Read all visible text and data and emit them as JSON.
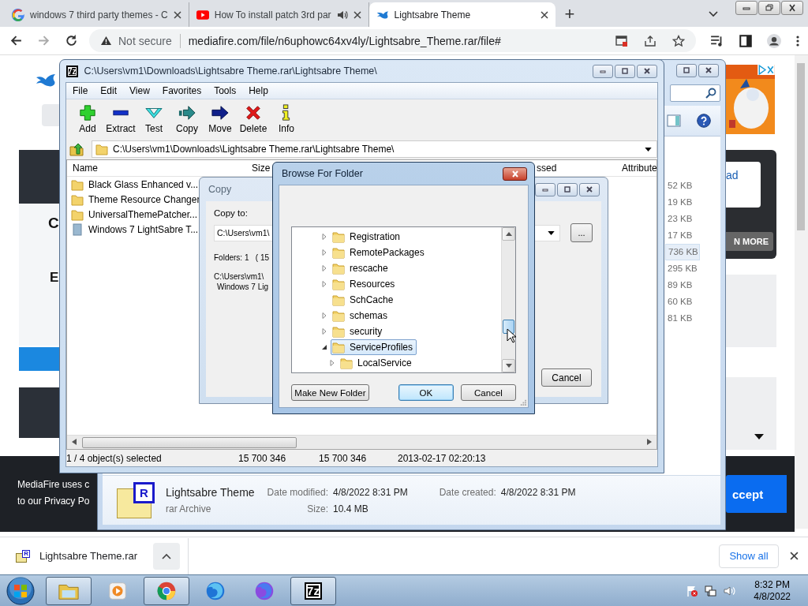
{
  "browser": {
    "tabs": [
      {
        "title": "windows 7 third party themes - C",
        "kind": "google",
        "audio": false,
        "selected": false
      },
      {
        "title": "How To install patch 3rd par",
        "kind": "youtube",
        "audio": true,
        "selected": false
      },
      {
        "title": "Lightsabre Theme",
        "kind": "mediafire",
        "audio": false,
        "selected": true
      }
    ],
    "new_tab": "+",
    "security": "Not secure",
    "url": "mediafire.com/file/n6uphowc64xv4ly/Lightsabre_Theme.rar/file#"
  },
  "webpage": {
    "headings": [
      "C",
      "E"
    ],
    "side_link": "ad",
    "side_button": "N MORE",
    "cookie_lines": [
      "MediaFire uses c",
      "to our Privacy Po"
    ],
    "cookie_button": "ccept"
  },
  "explorer": {
    "sizes": [
      {
        "text": "52 KB",
        "selected": false
      },
      {
        "text": "19 KB",
        "selected": false
      },
      {
        "text": "23 KB",
        "selected": false
      },
      {
        "text": "17 KB",
        "selected": false
      },
      {
        "text": "736 KB",
        "selected": true
      },
      {
        "text": "295 KB",
        "selected": false
      },
      {
        "text": "89 KB",
        "selected": false
      },
      {
        "text": "60 KB",
        "selected": false
      },
      {
        "text": "81 KB",
        "selected": false
      }
    ],
    "details": {
      "icon_letter": "R",
      "name": "Lightsabre Theme",
      "type": "rar Archive",
      "fields": [
        {
          "label": "Date modified:",
          "value": "4/8/2022 8:31 PM"
        },
        {
          "label": "Size:",
          "value": "10.4 MB"
        },
        {
          "label": "Date created:",
          "value": "4/8/2022 8:31 PM"
        }
      ]
    }
  },
  "sevenzip": {
    "icon_text": "7z",
    "title": "C:\\Users\\vm1\\Downloads\\Lightsabre Theme.rar\\Lightsabre Theme\\",
    "menu": [
      "File",
      "Edit",
      "View",
      "Favorites",
      "Tools",
      "Help"
    ],
    "toolbar": [
      {
        "label": "Add",
        "kind": "add"
      },
      {
        "label": "Extract",
        "kind": "extract"
      },
      {
        "label": "Test",
        "kind": "test"
      },
      {
        "label": "Copy",
        "kind": "copy"
      },
      {
        "label": "Move",
        "kind": "move"
      },
      {
        "label": "Delete",
        "kind": "delete"
      },
      {
        "label": "Info",
        "kind": "info"
      }
    ],
    "path": "C:\\Users\\vm1\\Downloads\\Lightsabre Theme.rar\\Lightsabre Theme\\",
    "columns": [
      "Name",
      "Size",
      "ssed",
      "Attribute"
    ],
    "files": [
      {
        "name": "Black Glass Enhanced v...",
        "kind": "folder"
      },
      {
        "name": "Theme Resource Changer",
        "kind": "folder"
      },
      {
        "name": "UniversalThemePatcher...",
        "kind": "folder"
      },
      {
        "name": "Windows 7 LightSabre T...",
        "kind": "file"
      }
    ],
    "status": [
      "1 / 4 object(s) selected",
      "15 700 346",
      "15 700 346",
      "2013-02-17 02:20:13"
    ]
  },
  "copy_dialog": {
    "title": "Copy",
    "label": "Copy to:",
    "path": "C:\\Users\\vm1\\",
    "folders": "Folders: 1   ( 15",
    "info_lines": [
      "C:\\Users\\vm1\\",
      "Windows 7 Lig"
    ],
    "browse": "...",
    "cancel": "Cancel"
  },
  "browse_dialog": {
    "title": "Browse For Folder",
    "tree": [
      {
        "name": "Registration",
        "expanded": false,
        "selected": false
      },
      {
        "name": "RemotePackages",
        "expanded": false,
        "selected": false
      },
      {
        "name": "rescache",
        "expanded": false,
        "selected": false
      },
      {
        "name": "Resources",
        "expanded": false,
        "selected": false
      },
      {
        "name": "SchCache",
        "selected": false
      },
      {
        "name": "schemas",
        "expanded": false,
        "selected": false
      },
      {
        "name": "security",
        "expanded": false,
        "selected": false
      },
      {
        "name": "ServiceProfiles",
        "expanded": true,
        "selected": true,
        "children": [
          {
            "name": "LocalService",
            "expanded": false,
            "selected": false
          }
        ]
      }
    ],
    "buttons": [
      {
        "label": "Make New Folder",
        "default": false
      },
      {
        "label": "OK",
        "default": true
      },
      {
        "label": "Cancel",
        "default": false
      }
    ]
  },
  "downloads": {
    "icon_letter": "R",
    "file": "Lightsabre Theme.rar",
    "show_all": "Show all"
  },
  "taskbar": {
    "apps": [
      {
        "kind": "explorer",
        "open": true
      },
      {
        "kind": "media",
        "open": false
      },
      {
        "kind": "chrome",
        "open": true
      },
      {
        "kind": "firefox",
        "open": false
      },
      {
        "kind": "firefox-dev",
        "open": false
      },
      {
        "kind": "sevenzip",
        "label": "7z",
        "open": true
      }
    ],
    "time": "8:32 PM",
    "date": "4/8/2022"
  }
}
